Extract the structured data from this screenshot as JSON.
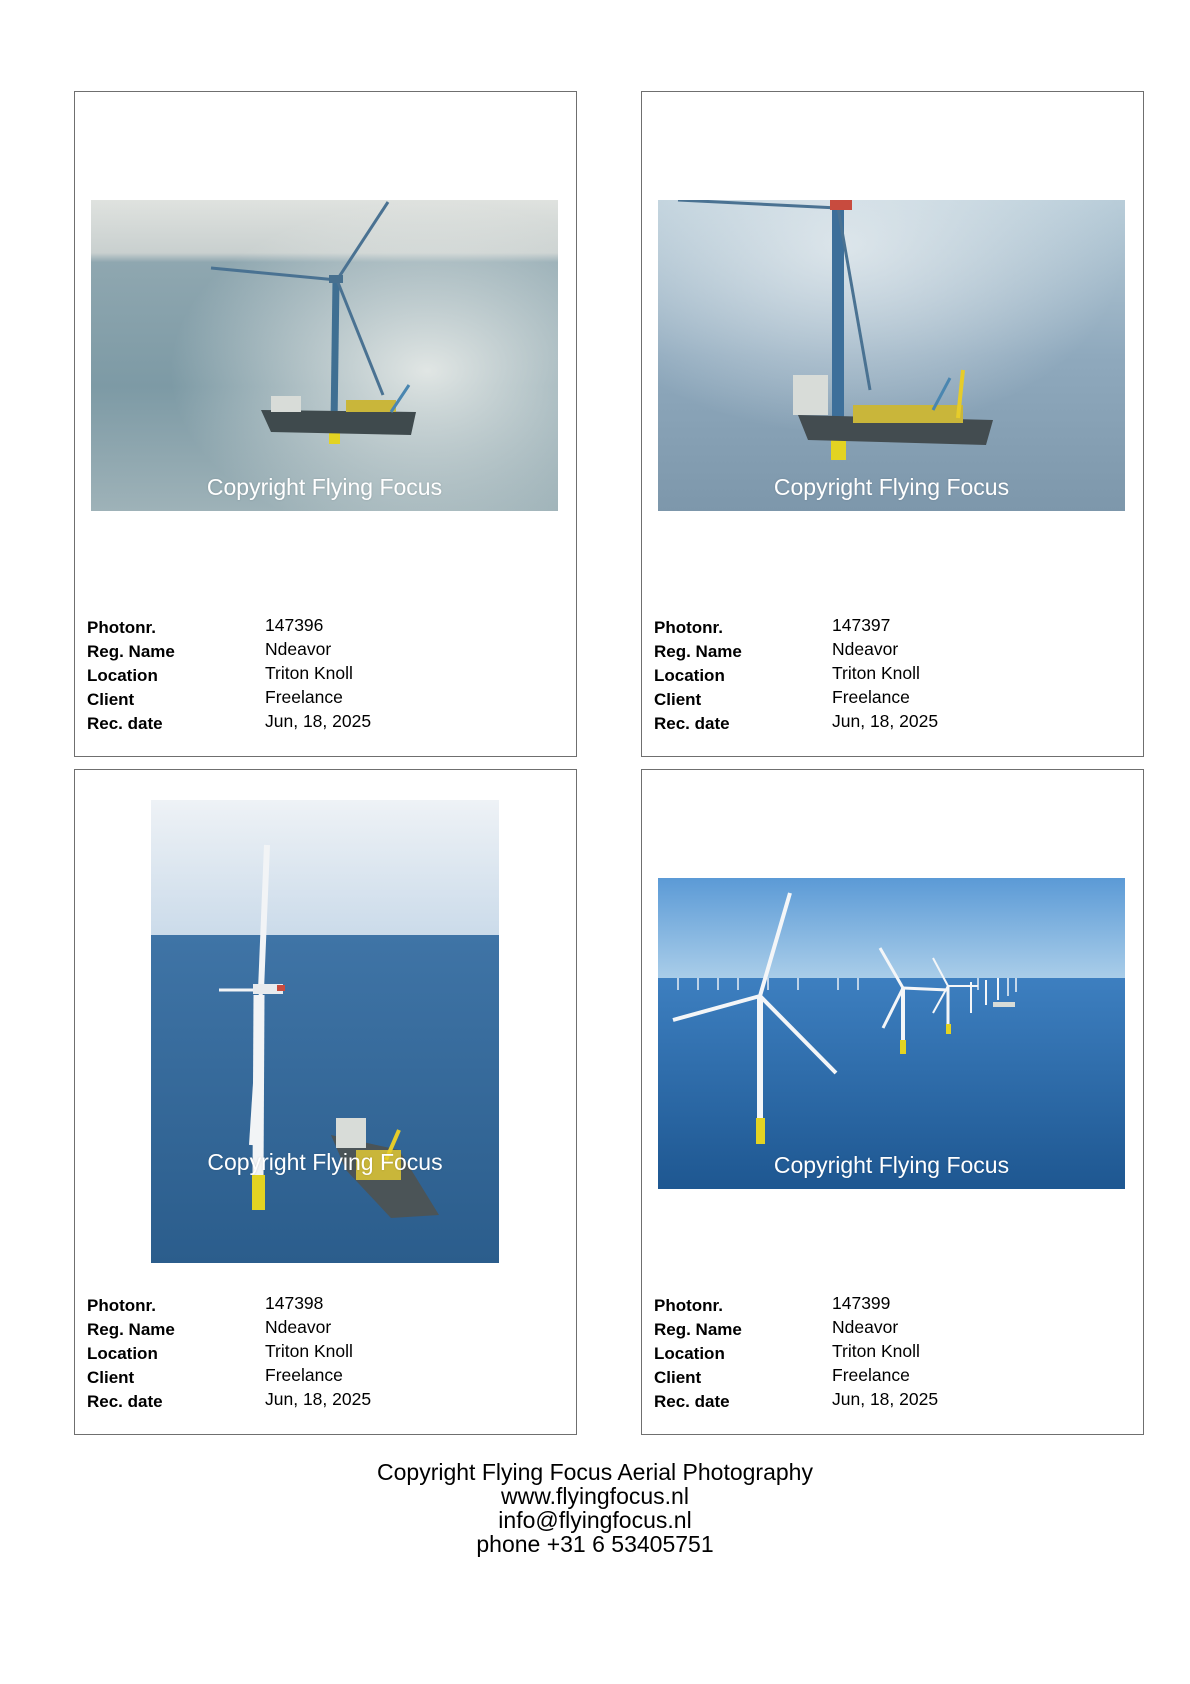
{
  "watermark": "Copyright Flying Focus",
  "labels": {
    "photonr": "Photonr.",
    "reg_name": "Reg. Name",
    "location": "Location",
    "client": "Client",
    "rec_date": "Rec. date"
  },
  "cards": [
    {
      "photonr": "147396",
      "reg_name": "Ndeavor",
      "location": "Triton Knoll",
      "client": "Freelance",
      "rec_date": "Jun, 18, 2025"
    },
    {
      "photonr": "147397",
      "reg_name": "Ndeavor",
      "location": "Triton Knoll",
      "client": "Freelance",
      "rec_date": "Jun, 18, 2025"
    },
    {
      "photonr": "147398",
      "reg_name": "Ndeavor",
      "location": "Triton Knoll",
      "client": "Freelance",
      "rec_date": "Jun, 18, 2025"
    },
    {
      "photonr": "147399",
      "reg_name": "Ndeavor",
      "location": "Triton Knoll",
      "client": "Freelance",
      "rec_date": "Jun, 18, 2025"
    }
  ],
  "footer": {
    "line1": "Copyright Flying Focus Aerial Photography",
    "line2": "www.flyingfocus.nl",
    "line3": "info@flyingfocus.nl",
    "line4": "phone +31 6 53405751"
  }
}
